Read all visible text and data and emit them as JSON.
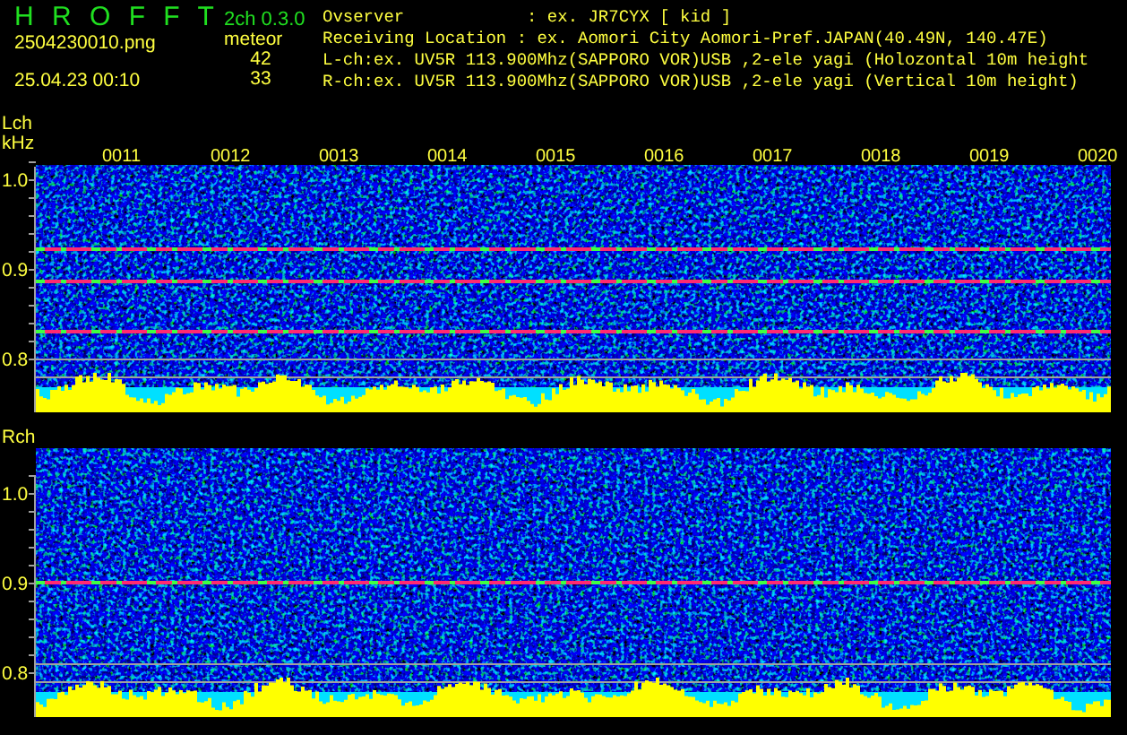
{
  "app": {
    "title": "H R O F F T",
    "version": "2ch 0.3.0",
    "mode": "meteor",
    "filename": "2504230010.png",
    "timestamp": "25.04.23 00:10",
    "counts": [
      "42",
      "33"
    ]
  },
  "info_lines": [
    "Ovserver            : ex. JR7CYX [ kid ]",
    "Receiving Location : ex. Aomori City Aomori-Pref.JAPAN(40.49N, 140.47E)",
    "L-ch:ex. UV5R 113.900Mhz(SAPPORO VOR)USB ,2-ele yagi (Holozontal 10m height",
    "R-ch:ex. UV5R 113.900Mhz(SAPPORO VOR)USB ,2-ele yagi (Vertical 10m height)"
  ],
  "time_labels": [
    "0011",
    "0012",
    "0013",
    "0014",
    "0015",
    "0016",
    "0017",
    "0018",
    "0019",
    "0020"
  ],
  "panels": [
    {
      "channel": "Lch",
      "unit": "kHz",
      "yticks": [
        "1.0",
        "0.9",
        "0.8"
      ]
    },
    {
      "channel": "Rch",
      "yticks": [
        "1.0",
        "0.9",
        "0.8"
      ]
    }
  ]
}
